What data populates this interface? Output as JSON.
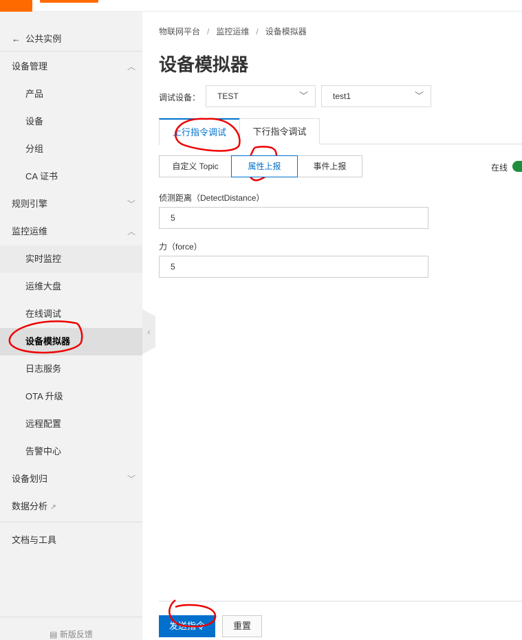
{
  "sidebar": {
    "back_label": "公共实例",
    "items": [
      {
        "label": "设备管理",
        "chevron": "up"
      },
      {
        "label": "产品"
      },
      {
        "label": "设备"
      },
      {
        "label": "分组"
      },
      {
        "label": "CA 证书"
      },
      {
        "label": "规则引擎",
        "chevron": "down"
      },
      {
        "label": "监控运维",
        "chevron": "up"
      },
      {
        "label": "实时监控"
      },
      {
        "label": "运维大盘"
      },
      {
        "label": "在线调试"
      },
      {
        "label": "设备模拟器",
        "active": true
      },
      {
        "label": "日志服务"
      },
      {
        "label": "OTA 升级"
      },
      {
        "label": "远程配置"
      },
      {
        "label": "告警中心"
      },
      {
        "label": "设备划归",
        "chevron": "down"
      },
      {
        "label": "数据分析"
      },
      {
        "label": "文档与工具"
      }
    ],
    "feedback_label": "新版反馈"
  },
  "breadcrumb": [
    "物联网平台",
    "监控运维",
    "设备模拟器"
  ],
  "page_title": "设备模拟器",
  "device_label": "调试设备：",
  "product_select": "TEST",
  "device_select": "test1",
  "tabs": [
    "上行指令调试",
    "下行指令调试"
  ],
  "segments": [
    "自定义 Topic",
    "属性上报",
    "事件上报"
  ],
  "status_label": "在线",
  "fields": [
    {
      "label": "侦测距离（DetectDistance）",
      "value": "5"
    },
    {
      "label": "力（force）",
      "value": "5"
    }
  ],
  "buttons": {
    "send": "发送指令",
    "reset": "重置"
  },
  "colors": {
    "brand": "#ff6a00",
    "primary": "#0070cc",
    "online": "#1e8e3e"
  }
}
